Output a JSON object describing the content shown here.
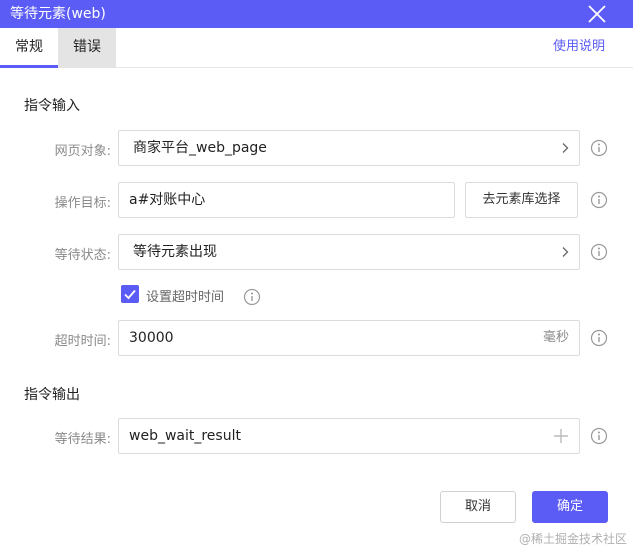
{
  "window": {
    "title": "等待元素(web)"
  },
  "tabs": [
    {
      "label": "常规"
    },
    {
      "label": "错误"
    }
  ],
  "help_link": "使用说明",
  "input_section": {
    "title": "指令输入",
    "web_object": {
      "label": "网页对象:",
      "value": "商家平台_web_page"
    },
    "target": {
      "label": "操作目标:",
      "value": "a#对账中心",
      "pick_button": "去元素库选择"
    },
    "wait_state": {
      "label": "等待状态:",
      "value": "等待元素出现"
    },
    "timeout_checkbox": {
      "label": "设置超时时间",
      "checked": true
    },
    "timeout": {
      "label": "超时时间:",
      "value": "30000",
      "unit": "毫秒"
    }
  },
  "output_section": {
    "title": "指令输出",
    "result": {
      "label": "等待结果:",
      "value": "web_wait_result"
    }
  },
  "buttons": {
    "cancel": "取消",
    "ok": "确定"
  },
  "watermark": "@稀土掘金技术社区",
  "colors": {
    "accent": "#5b5bf6",
    "label": "#8a8a8a",
    "border": "#dcdcdc"
  },
  "icons": {
    "close": "close-icon",
    "chevron": "chevron-right-icon",
    "info": "info-icon",
    "plus": "plus-icon",
    "check": "check-icon"
  }
}
